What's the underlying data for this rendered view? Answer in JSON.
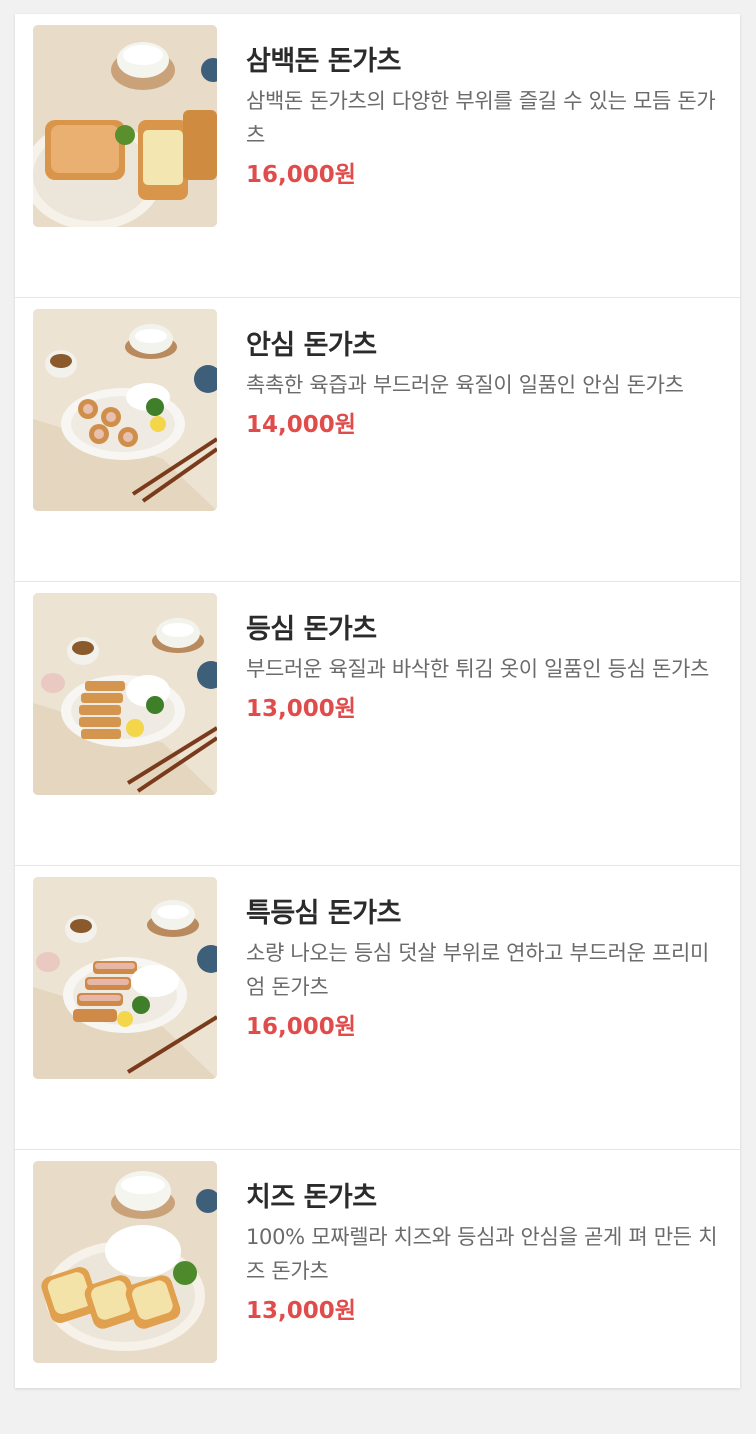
{
  "theme": {
    "price_color": "#e04c4c",
    "title_color": "#2b2b2b",
    "desc_color": "#6b6b6b"
  },
  "menu": {
    "items": [
      {
        "name": "삼백돈 돈가츠",
        "desc": "삼백돈 돈가츠의 다양한 부위를 즐길 수 있는 모듬 돈가츠",
        "price": "16,000원",
        "photo": "assorted-tonkatsu-photo"
      },
      {
        "name": "안심 돈가츠",
        "desc": "촉촉한 육즙과 부드러운 육질이 일품인 안심 돈가츠",
        "price": "14,000원",
        "photo": "tenderloin-tonkatsu-photo"
      },
      {
        "name": "등심 돈가츠",
        "desc": "부드러운 육질과 바삭한 튀김 옷이 일품인 등심 돈가츠",
        "price": "13,000원",
        "photo": "sirloin-tonkatsu-photo"
      },
      {
        "name": "특등심 돈가츠",
        "desc": "소량 나오는 등심 덧살 부위로 연하고 부드러운 프리미엄 돈가츠",
        "price": "16,000원",
        "photo": "premium-sirloin-tonkatsu-photo"
      },
      {
        "name": "치즈 돈가츠",
        "desc": "100% 모짜렐라 치즈와 등심과 안심을 곧게 펴 만든 치즈 돈가츠",
        "price": "13,000원",
        "photo": "cheese-tonkatsu-photo"
      }
    ]
  }
}
